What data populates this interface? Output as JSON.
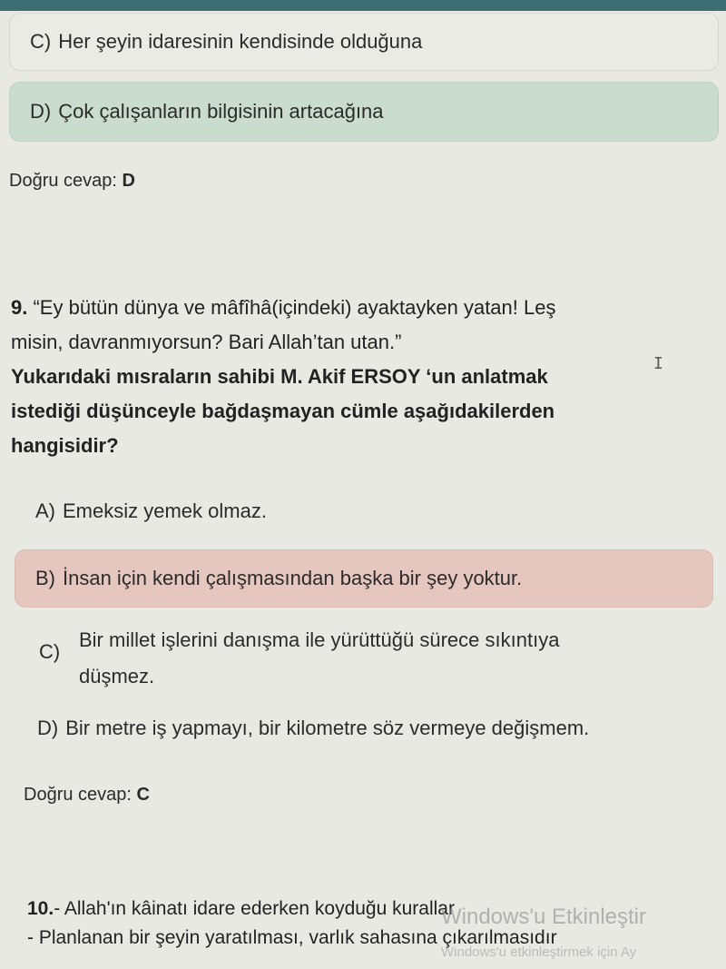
{
  "prev_question": {
    "option_c": {
      "letter": "C)",
      "text": "Her şeyin idaresinin kendisinde olduğuna"
    },
    "option_d": {
      "letter": "D)",
      "text": "Çok çalışanların bilgisinin artacağına"
    },
    "answer_label": "Doğru cevap:",
    "answer_value": "D"
  },
  "question9": {
    "number": "9.",
    "quote_line1": "“Ey bütün dünya ve mâfîhâ(içindeki) ayaktayken yatan! Leş",
    "quote_line2": "misin, davranmıyorsun? Bari Allah’tan utan.”",
    "prompt_line1": "Yukarıdaki mısraların sahibi M. Akif ERSOY ‘un anlatmak",
    "prompt_line2": "istediği düşünceyle bağdaşmayan cümle aşağıdakilerden",
    "prompt_line3": "hangisidir?",
    "options": [
      {
        "letter": "A)",
        "text": "Emeksiz yemek olmaz."
      },
      {
        "letter": "B)",
        "text": "İnsan için kendi çalışmasından başka bir şey yoktur."
      },
      {
        "letter": "C)",
        "line1": "Bir millet işlerini danışma ile yürüttüğü sürece sıkıntıya",
        "line2": "düşmez."
      },
      {
        "letter": "D)",
        "text": "Bir metre iş yapmayı, bir kilometre söz vermeye değişmem."
      }
    ],
    "answer_label": "Doğru cevap:",
    "answer_value": "C"
  },
  "question10": {
    "number": "10.",
    "line1": "- Allah'ın kâinatı idare ederken koyduğu kurallar",
    "line2": "- Planlanan bir şeyin yaratılması, varlık sahasına çıkarılmasıdır"
  },
  "watermark": {
    "title": "Windows'u Etkinleştir",
    "subtitle": "Windows'u etkinleştirmek için Ay"
  },
  "colors": {
    "correct_highlight": "#c9dccd",
    "wrong_highlight": "#e6c7c0",
    "header_bar": "#3c6f74"
  }
}
